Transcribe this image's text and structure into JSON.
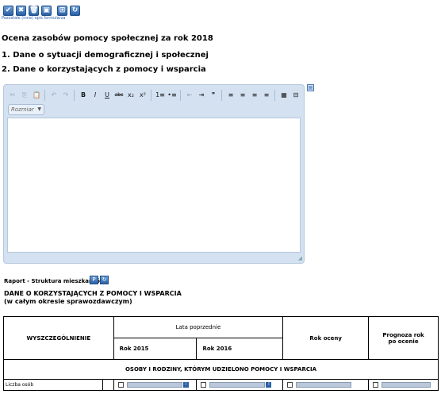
{
  "toolbar": {
    "buttons": [
      {
        "name": "save",
        "glyph": "✔"
      },
      {
        "name": "close",
        "glyph": "✖"
      },
      {
        "name": "delete",
        "glyph": "🗑"
      },
      {
        "name": "disk",
        "glyph": "▣"
      },
      {
        "name": "grid",
        "glyph": "⊞"
      },
      {
        "name": "refresh",
        "glyph": "↻"
      }
    ],
    "hint": "Pozostałe (inne) opis formularza"
  },
  "page": {
    "title": "Ocena zasobów pomocy społecznej za rok 2018",
    "section1": "1. Dane o sytuacji demograficznej i społecznej",
    "section2": "2. Dane o korzystających z pomocy i wsparcia"
  },
  "editor": {
    "size_placeholder": "Rozmiar",
    "tools": [
      "✂",
      "⎘",
      "📋",
      "↶",
      "↷",
      "B",
      "I",
      "U",
      "abc",
      "x₂",
      "x²",
      "1≡",
      "•≡",
      "⇤",
      "⇥",
      "❞",
      "≡",
      "≡",
      "≡",
      "≡",
      "▦",
      "⊟"
    ]
  },
  "report": {
    "label": "Raport - Struktura mieszkańców",
    "title_line1": "DANE O KORZYSTAJĄCYCH Z POMOCY I WSPARCIA",
    "title_line2": "(w całym okresie sprawozdawczym)"
  },
  "table": {
    "col_spec": "WYSZCZEGÓLNIENIE",
    "col_prev": "Lata poprzednie",
    "col_rate": "Rok oceny",
    "col_forecast": "Prognoza rok po ocenie",
    "year1": "Rok 2015",
    "year2": "Rok 2016",
    "section_row": "OSOBY I RODZINY, KTÓRYM UDZIELONO POMOCY I WSPARCIA",
    "row1_label": "Liczba osób"
  }
}
